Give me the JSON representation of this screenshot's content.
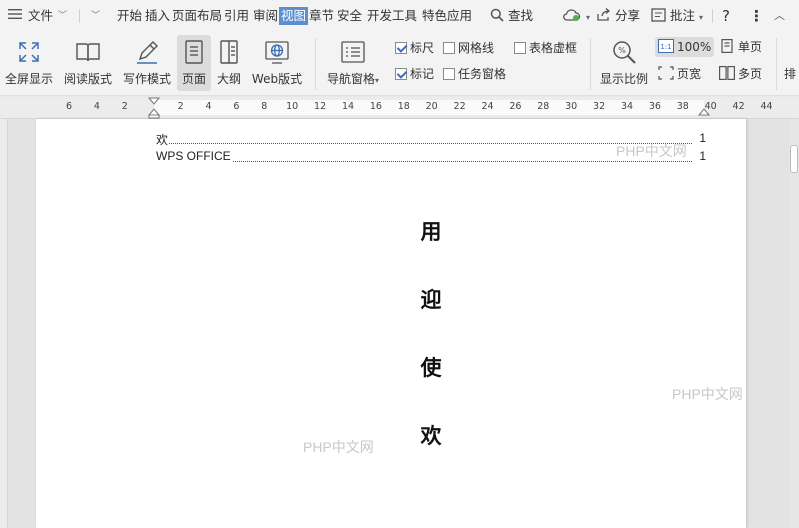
{
  "menubar": {
    "file": "文件",
    "tabs": [
      "开始",
      "插入",
      "页面布局",
      "引用",
      "审阅",
      "视图",
      "章节",
      "安全",
      "开发工具",
      "特色应用"
    ],
    "active_tab": "视图",
    "search": "查找",
    "share": "分享",
    "comment": "批注"
  },
  "ribbon": {
    "views": [
      {
        "label": "全屏显示",
        "icon": "fullscreen-icon"
      },
      {
        "label": "阅读版式",
        "icon": "book-icon"
      },
      {
        "label": "写作模式",
        "icon": "pen-icon"
      },
      {
        "label": "页面",
        "icon": "page-icon"
      },
      {
        "label": "大纲",
        "icon": "outline-icon"
      },
      {
        "label": "Web版式",
        "icon": "web-icon"
      }
    ],
    "nav_pane": "导航窗格",
    "checks": {
      "ruler": "标尺",
      "gridlines": "网格线",
      "table_gridlines": "表格虚框",
      "marks": "标记",
      "task_pane": "任务窗格"
    },
    "zoom": "显示比例",
    "zoom_100": "100%",
    "page_width": "页宽",
    "single_page": "单页",
    "multi_page": "多页",
    "cut_char": "排"
  },
  "ruler": {
    "ticks": [
      "6",
      "4",
      "2",
      "2",
      "4",
      "6",
      "8",
      "10",
      "12",
      "14",
      "16",
      "18",
      "20",
      "22",
      "24",
      "26",
      "28",
      "30",
      "32",
      "34",
      "36",
      "38",
      "40",
      "42",
      "44"
    ]
  },
  "document": {
    "toc": [
      {
        "text": "欢",
        "page": "1"
      },
      {
        "text": "WPS OFFICE",
        "page": "1"
      }
    ],
    "vertical_text": [
      "用",
      "迎",
      "使",
      "欢"
    ],
    "watermarks": [
      "PHP中文网",
      "PHP中文网",
      "PHP中文网"
    ]
  },
  "colors": {
    "active_tab_bg": "#5b8fd0",
    "check_mark": "#3b6fb6"
  }
}
